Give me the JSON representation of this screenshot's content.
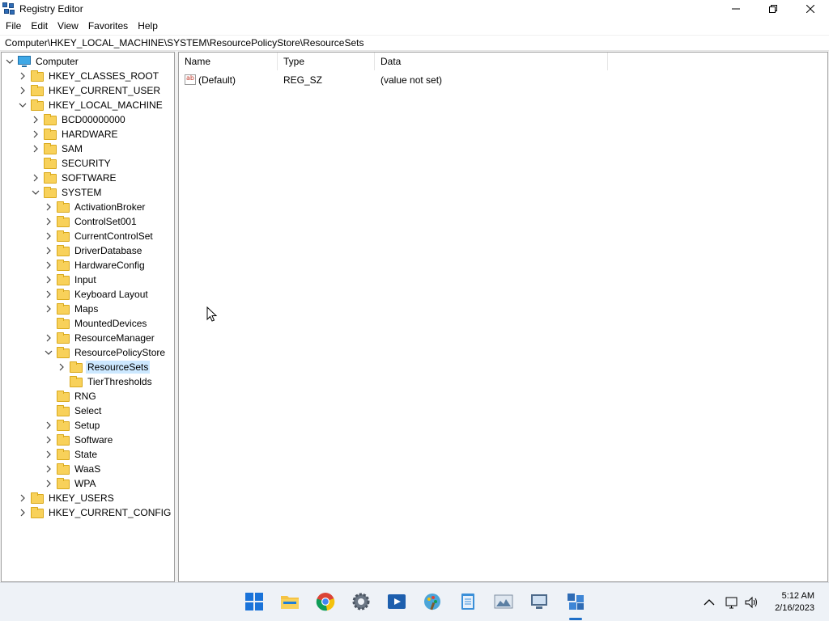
{
  "window": {
    "title": "Registry Editor",
    "icon": "registry-icon"
  },
  "menu": [
    "File",
    "Edit",
    "View",
    "Favorites",
    "Help"
  ],
  "address": "Computer\\HKEY_LOCAL_MACHINE\\SYSTEM\\ResourcePolicyStore\\ResourceSets",
  "tree": [
    {
      "label": "Computer",
      "depth": 0,
      "expander": "expanded",
      "icon": "computer-icon"
    },
    {
      "label": "HKEY_CLASSES_ROOT",
      "depth": 1,
      "expander": "collapsed",
      "icon": "folder-icon"
    },
    {
      "label": "HKEY_CURRENT_USER",
      "depth": 1,
      "expander": "collapsed",
      "icon": "folder-icon"
    },
    {
      "label": "HKEY_LOCAL_MACHINE",
      "depth": 1,
      "expander": "expanded",
      "icon": "folder-icon"
    },
    {
      "label": "BCD00000000",
      "depth": 2,
      "expander": "collapsed",
      "icon": "folder-icon"
    },
    {
      "label": "HARDWARE",
      "depth": 2,
      "expander": "collapsed",
      "icon": "folder-icon"
    },
    {
      "label": "SAM",
      "depth": 2,
      "expander": "collapsed",
      "icon": "folder-icon"
    },
    {
      "label": "SECURITY",
      "depth": 2,
      "expander": "none",
      "icon": "folder-icon"
    },
    {
      "label": "SOFTWARE",
      "depth": 2,
      "expander": "collapsed",
      "icon": "folder-icon"
    },
    {
      "label": "SYSTEM",
      "depth": 2,
      "expander": "expanded",
      "icon": "folder-icon"
    },
    {
      "label": "ActivationBroker",
      "depth": 3,
      "expander": "collapsed",
      "icon": "folder-icon"
    },
    {
      "label": "ControlSet001",
      "depth": 3,
      "expander": "collapsed",
      "icon": "folder-icon"
    },
    {
      "label": "CurrentControlSet",
      "depth": 3,
      "expander": "collapsed",
      "icon": "folder-icon"
    },
    {
      "label": "DriverDatabase",
      "depth": 3,
      "expander": "collapsed",
      "icon": "folder-icon"
    },
    {
      "label": "HardwareConfig",
      "depth": 3,
      "expander": "collapsed",
      "icon": "folder-icon"
    },
    {
      "label": "Input",
      "depth": 3,
      "expander": "collapsed",
      "icon": "folder-icon"
    },
    {
      "label": "Keyboard Layout",
      "depth": 3,
      "expander": "collapsed",
      "icon": "folder-icon"
    },
    {
      "label": "Maps",
      "depth": 3,
      "expander": "collapsed",
      "icon": "folder-icon"
    },
    {
      "label": "MountedDevices",
      "depth": 3,
      "expander": "none",
      "icon": "folder-icon"
    },
    {
      "label": "ResourceManager",
      "depth": 3,
      "expander": "collapsed",
      "icon": "folder-icon"
    },
    {
      "label": "ResourcePolicyStore",
      "depth": 3,
      "expander": "expanded",
      "icon": "folder-icon"
    },
    {
      "label": "ResourceSets",
      "depth": 4,
      "expander": "collapsed",
      "icon": "folder-icon",
      "selected": true
    },
    {
      "label": "TierThresholds",
      "depth": 4,
      "expander": "none",
      "icon": "folder-icon"
    },
    {
      "label": "RNG",
      "depth": 3,
      "expander": "none",
      "icon": "folder-icon"
    },
    {
      "label": "Select",
      "depth": 3,
      "expander": "none",
      "icon": "folder-icon"
    },
    {
      "label": "Setup",
      "depth": 3,
      "expander": "collapsed",
      "icon": "folder-icon"
    },
    {
      "label": "Software",
      "depth": 3,
      "expander": "collapsed",
      "icon": "folder-icon"
    },
    {
      "label": "State",
      "depth": 3,
      "expander": "collapsed",
      "icon": "folder-icon"
    },
    {
      "label": "WaaS",
      "depth": 3,
      "expander": "collapsed",
      "icon": "folder-icon"
    },
    {
      "label": "WPA",
      "depth": 3,
      "expander": "collapsed",
      "icon": "folder-icon"
    },
    {
      "label": "HKEY_USERS",
      "depth": 1,
      "expander": "collapsed",
      "icon": "folder-icon"
    },
    {
      "label": "HKEY_CURRENT_CONFIG",
      "depth": 1,
      "expander": "collapsed",
      "icon": "folder-icon"
    }
  ],
  "list": {
    "columns": [
      "Name",
      "Type",
      "Data"
    ],
    "rows": [
      {
        "name": "(Default)",
        "type": "REG_SZ",
        "data": "(value not set)",
        "icon": "string-value-icon"
      }
    ]
  },
  "taskbar": {
    "apps": [
      "start-icon",
      "file-explorer-icon",
      "chrome-icon",
      "settings-icon",
      "media-player-icon",
      "paint-icon",
      "notepad-icon",
      "photos-icon",
      "remote-desktop-icon",
      "registry-editor-icon"
    ],
    "active_app": "registry-editor-icon",
    "tray": [
      "chevron-up-icon",
      "network-icon",
      "volume-icon"
    ],
    "time": "5:12 AM",
    "date": "2/16/2023"
  },
  "colors": {
    "selection": "#cce8ff",
    "folder": "#f8d15a",
    "accent": "#1e6fc8"
  }
}
